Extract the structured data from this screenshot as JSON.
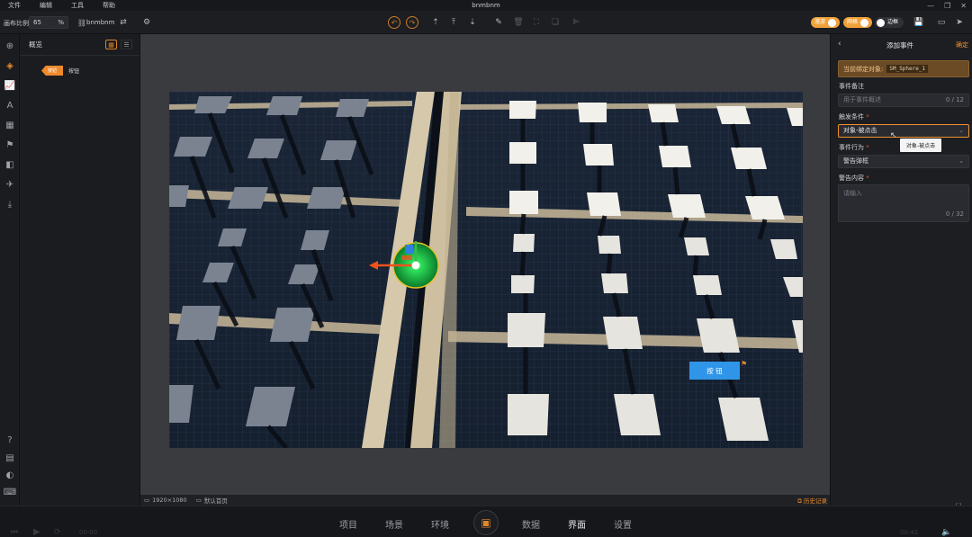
{
  "app": {
    "title": "bnmbnm"
  },
  "menu": [
    "文件",
    "编辑",
    "工具",
    "帮助"
  ],
  "toolbar": {
    "scale_label": "画布比例",
    "scale_value": "65",
    "scale_unit": "%",
    "project_name": "bnmbnm",
    "toggles": [
      {
        "label": "漫游",
        "color": "#f0a23a"
      },
      {
        "label": "网格",
        "color": "#f0a23a"
      },
      {
        "label": "边框",
        "color": "#3a3b40"
      }
    ]
  },
  "outline": {
    "title": "概览",
    "node_badge": "按钮",
    "node_label": "按钮"
  },
  "canvas": {
    "resolution": "1920×1080",
    "homepage": "默认首页",
    "history": "历史记录",
    "button_label": "按 钮"
  },
  "props": {
    "title": "添加事件",
    "confirm": "确定",
    "bound_label": "当前绑定对象:",
    "bound_value": "SM_Sphere_1",
    "note_label": "事件备注",
    "note_placeholder": "用于事件概述",
    "note_count": "0 / 12",
    "trigger_label": "触发条件",
    "trigger_value": "对象-被点击",
    "tooltip": "对象-被点击",
    "action_label": "事件行为",
    "action_value": "警告弹框",
    "content_label": "警告内容",
    "content_placeholder": "请输入",
    "content_count": "0 / 32",
    "accent": "#f0902f"
  },
  "bottom_nav": {
    "items": [
      "项目",
      "场景",
      "环境",
      "数据",
      "界面",
      "设置"
    ],
    "active": "界面"
  },
  "player": {
    "time_left": "00:00",
    "time_right": "00:41"
  }
}
